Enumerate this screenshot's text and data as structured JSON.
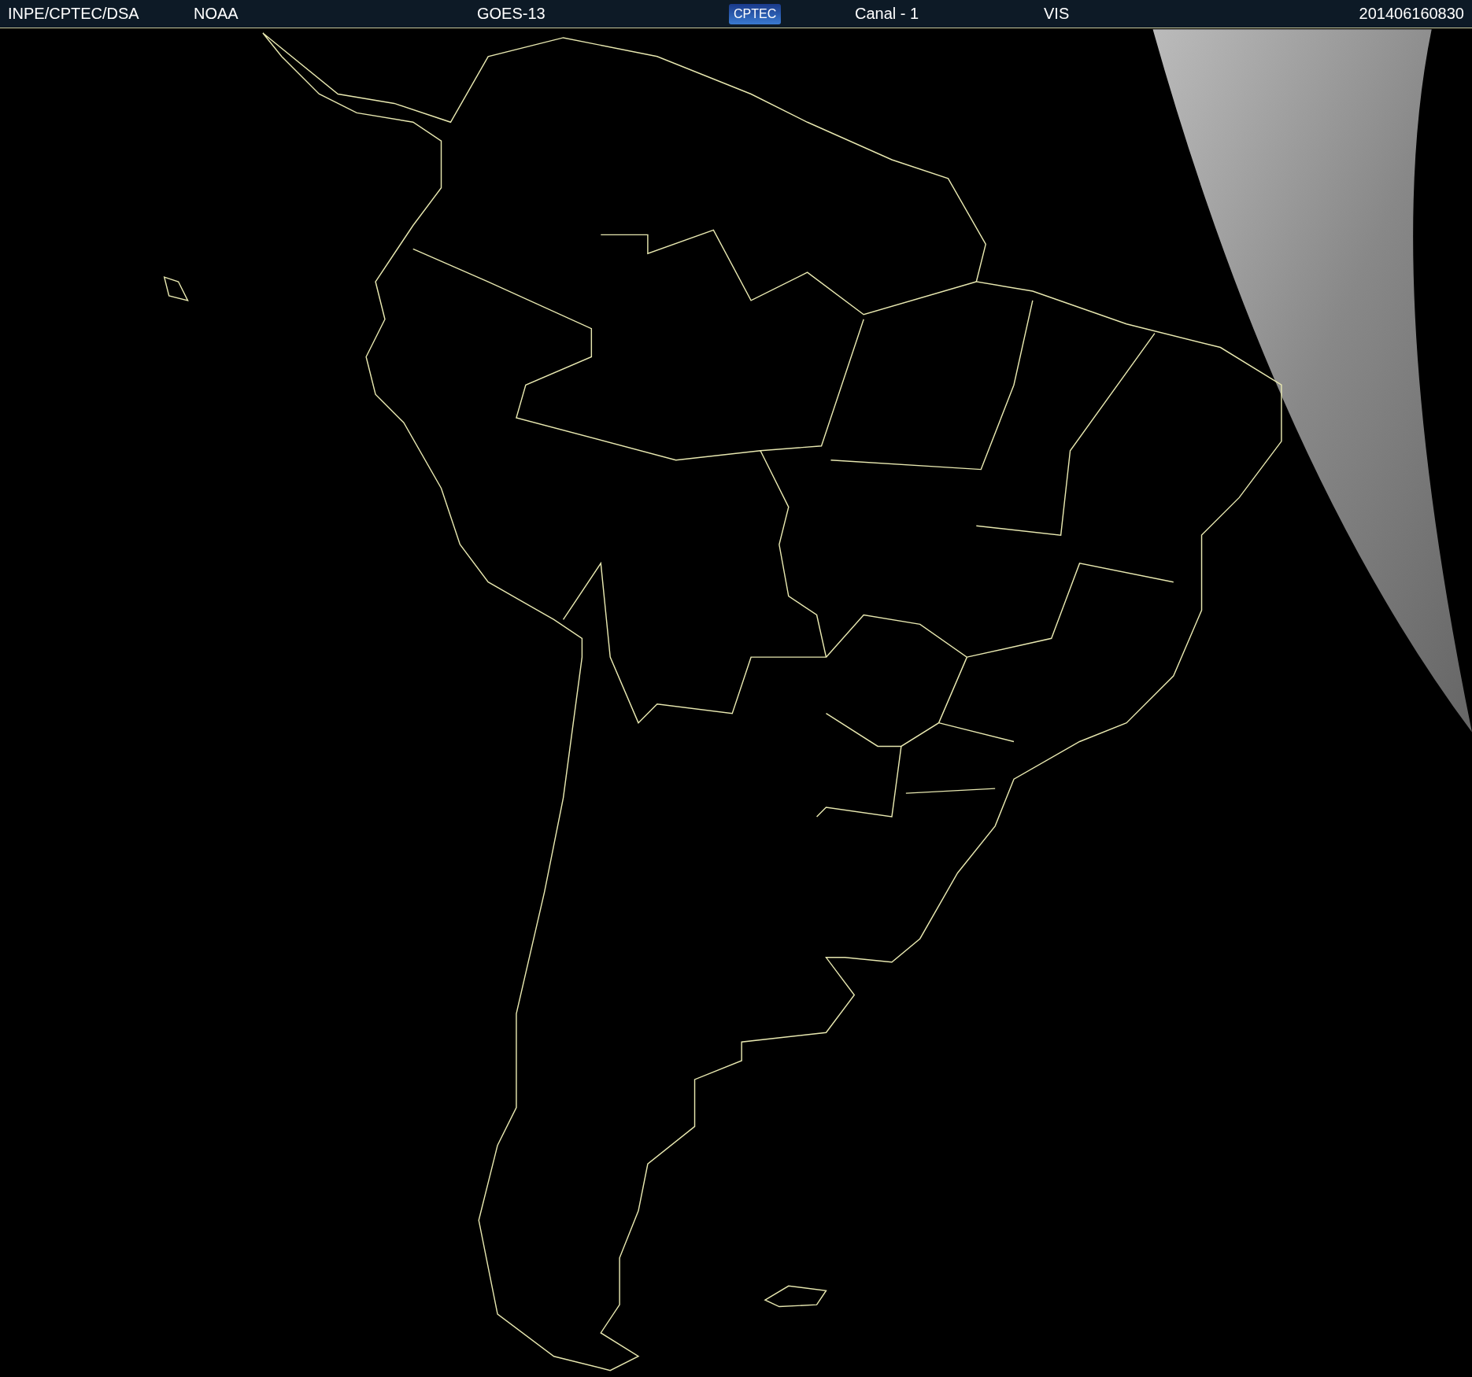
{
  "header": {
    "agency": "INPE/CPTEC/DSA",
    "source": "NOAA",
    "satellite": "GOES-13",
    "logo": "CPTEC",
    "channel": "Canal - 1",
    "band": "VIS",
    "timestamp": "201406160830"
  }
}
